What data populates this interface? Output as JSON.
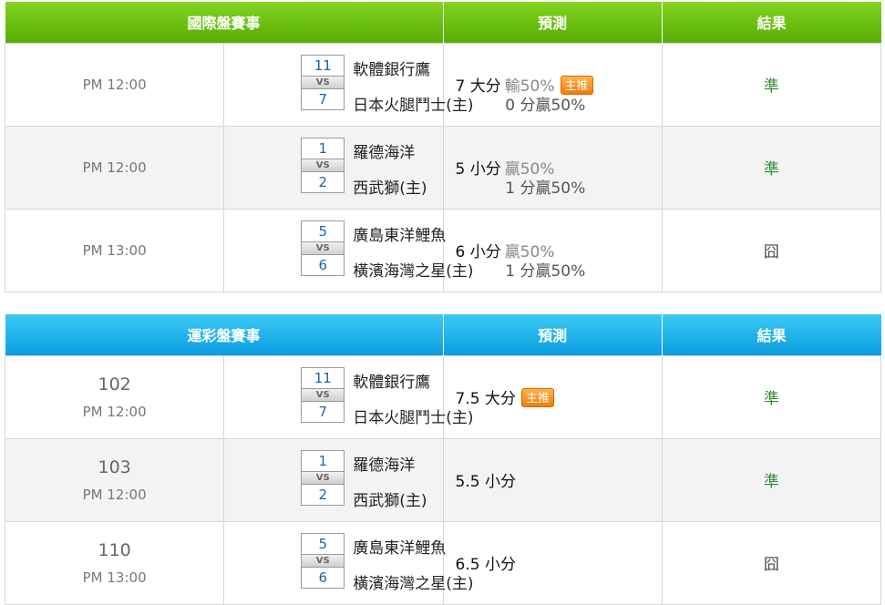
{
  "intl": {
    "header": {
      "title": "國際盤賽事",
      "pred": "預測",
      "result": "結果"
    },
    "rows": [
      {
        "time": "PM 12:00",
        "s1": "11",
        "vs": "VS",
        "s2": "7",
        "team1": "軟體銀行鷹",
        "team2": "日本火腿鬥士(主)",
        "handicap": "0 分贏50%",
        "pred_main": "7 大分",
        "pred_extra": "輸50%",
        "badge": "主推",
        "result": "準"
      },
      {
        "time": "PM 12:00",
        "s1": "1",
        "vs": "VS",
        "s2": "2",
        "team1": "羅德海洋",
        "team2": "西武獅(主)",
        "handicap": "1 分贏50%",
        "pred_main": "5 小分",
        "pred_extra": "贏50%",
        "badge": "",
        "result": "準"
      },
      {
        "time": "PM 13:00",
        "s1": "5",
        "vs": "VS",
        "s2": "6",
        "team1": "廣島東洋鯉魚",
        "team2": "橫濱海灣之星(主)",
        "handicap": "1 分贏50%",
        "pred_main": "6 小分",
        "pred_extra": "贏50%",
        "badge": "",
        "result": "囧"
      }
    ]
  },
  "sport": {
    "header": {
      "title": "運彩盤賽事",
      "pred": "預測",
      "result": "結果"
    },
    "rows": [
      {
        "num": "102",
        "time": "PM 12:00",
        "s1": "11",
        "vs": "VS",
        "s2": "7",
        "team1": "軟體銀行鷹",
        "team2": "日本火腿鬥士(主)",
        "pred_main": "7.5 大分",
        "badge": "主推",
        "result": "準"
      },
      {
        "num": "103",
        "time": "PM 12:00",
        "s1": "1",
        "vs": "VS",
        "s2": "2",
        "team1": "羅德海洋",
        "team2": "西武獅(主)",
        "pred_main": "5.5 小分",
        "badge": "",
        "result": "準"
      },
      {
        "num": "110",
        "time": "PM 13:00",
        "s1": "5",
        "vs": "VS",
        "s2": "6",
        "team1": "廣島東洋鯉魚",
        "team2": "橫濱海灣之星(主)",
        "pred_main": "6.5 小分",
        "badge": "",
        "result": "囧"
      }
    ]
  },
  "colors": {
    "intl_header": "#6cc20f",
    "sport_header": "#20b4ec",
    "badge": "#f4890f",
    "win": "#2e8b2e"
  }
}
